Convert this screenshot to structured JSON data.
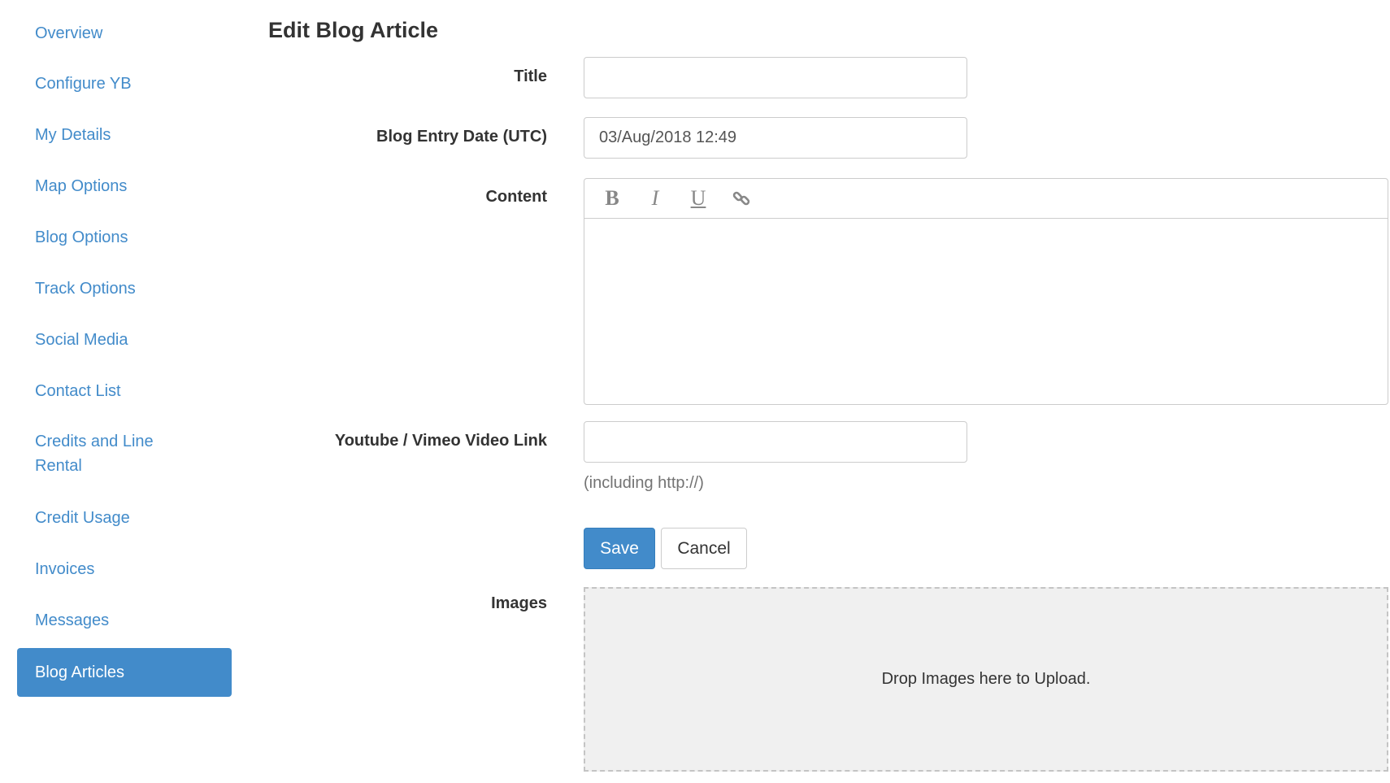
{
  "sidebar": {
    "items": [
      {
        "label": "Overview"
      },
      {
        "label": "Configure YB"
      },
      {
        "label": "My Details"
      },
      {
        "label": "Map Options"
      },
      {
        "label": "Blog Options"
      },
      {
        "label": "Track Options"
      },
      {
        "label": "Social Media"
      },
      {
        "label": "Contact List"
      },
      {
        "label": "Credits and Line Rental"
      },
      {
        "label": "Credit Usage"
      },
      {
        "label": "Invoices"
      },
      {
        "label": "Messages"
      },
      {
        "label": "Blog Articles",
        "active": true
      }
    ]
  },
  "form": {
    "heading": "Edit Blog Article",
    "title_label": "Title",
    "title_value": "",
    "date_label": "Blog Entry Date (UTC)",
    "date_value": "03/Aug/2018 12:49",
    "content_label": "Content",
    "toolbar": {
      "bold": "B",
      "italic": "I",
      "underline": "U",
      "link_icon": "link-icon"
    },
    "video_label": "Youtube / Vimeo Video Link",
    "video_value": "",
    "video_help": "(including http://)",
    "save_label": "Save",
    "cancel_label": "Cancel",
    "images_label": "Images",
    "dropzone_text": "Drop Images here to Upload."
  },
  "colors": {
    "accent": "#428bca",
    "border": "#cccccc",
    "dropzone_bg": "#f0f0f0"
  }
}
